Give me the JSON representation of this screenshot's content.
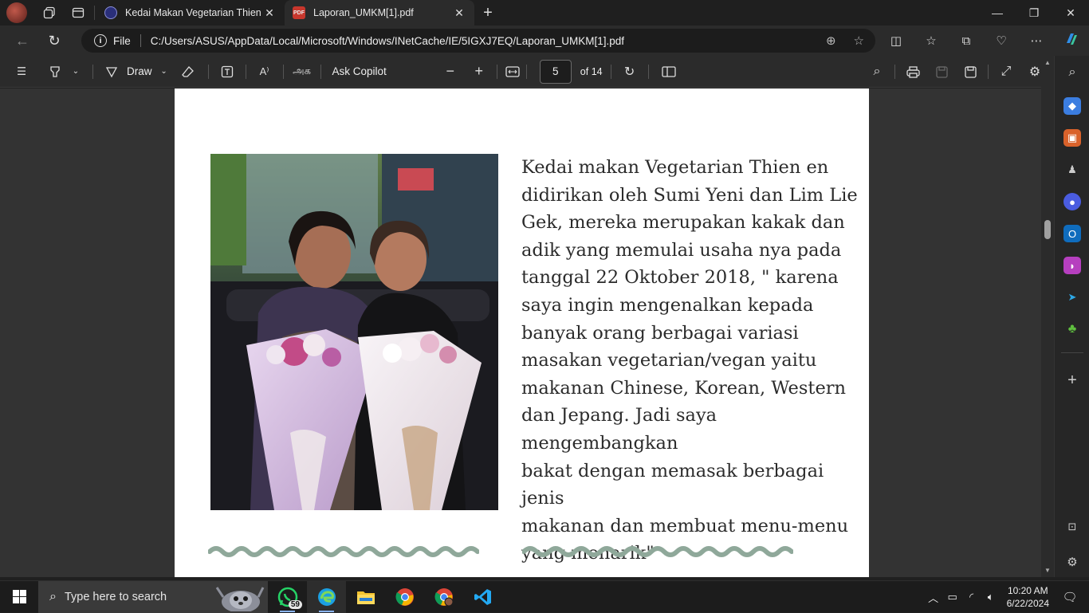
{
  "tabs": [
    {
      "title": "Kedai Makan Vegetarian Thien En",
      "icon": "site-favicon-icon",
      "active": false
    },
    {
      "title": "Laporan_UMKM[1].pdf",
      "icon": "pdf-icon",
      "active": true
    }
  ],
  "address": {
    "protocol_label": "File",
    "url": "C:/Users/ASUS/AppData/Local/Microsoft/Windows/INetCache/IE/5IGXJ7EQ/Laporan_UMKM[1].pdf"
  },
  "pdf_toolbar": {
    "draw_label": "Draw",
    "copilot_label": "Ask Copilot",
    "page_number": "5",
    "page_total": "of 14",
    "read_aloud_glyph": "A⁾",
    "translate_glyph": "அக"
  },
  "document": {
    "body_text": "Kedai makan Vegetarian Thien en\ndidirikan oleh Sumi Yeni dan Lim Lie\nGek, mereka merupakan kakak dan\nadik yang memulai usaha nya pada\ntanggal 22 Oktober 2018, \" karena\nsaya ingin mengenalkan kepada\nbanyak orang berbagai variasi\nmasakan vegetarian/vegan yaitu\nmakanan Chinese, Korean, Western\ndan Jepang. Jadi saya mengembangkan\nbakat dengan memasak berbagai jenis\nmakanan dan membuat menu-menu\nyang menarik\"",
    "photo": "two-women-holding-flower-bouquets-photo",
    "accent_color": "#8fa89a"
  },
  "taskbar": {
    "search_placeholder": "Type here to search",
    "whatsapp_badge": "59",
    "time": "10:20 AM",
    "date": "6/22/2024"
  }
}
